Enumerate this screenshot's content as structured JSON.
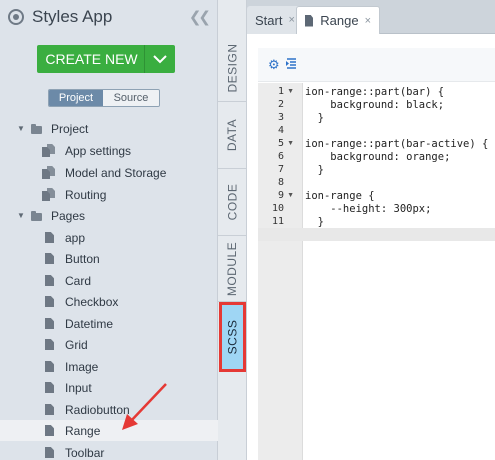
{
  "app": {
    "title": "Styles App"
  },
  "sidebar": {
    "create_button": "CREATE NEW",
    "segments": [
      "Project",
      "Source"
    ],
    "tree": [
      {
        "label": "Project",
        "kind": "folder",
        "level": 0
      },
      {
        "label": "App settings",
        "kind": "fileset",
        "level": 1
      },
      {
        "label": "Model and Storage",
        "kind": "fileset",
        "level": 1
      },
      {
        "label": "Routing",
        "kind": "fileset",
        "level": 1
      },
      {
        "label": "Pages",
        "kind": "folder",
        "level": 0
      },
      {
        "label": "app",
        "kind": "page",
        "level": 1
      },
      {
        "label": "Button",
        "kind": "file",
        "level": 1
      },
      {
        "label": "Card",
        "kind": "file",
        "level": 1
      },
      {
        "label": "Checkbox",
        "kind": "file",
        "level": 1
      },
      {
        "label": "Datetime",
        "kind": "file",
        "level": 1
      },
      {
        "label": "Grid",
        "kind": "file",
        "level": 1
      },
      {
        "label": "Image",
        "kind": "file",
        "level": 1
      },
      {
        "label": "Input",
        "kind": "file",
        "level": 1
      },
      {
        "label": "Radiobutton",
        "kind": "file",
        "level": 1
      },
      {
        "label": "Range",
        "kind": "file",
        "level": 1,
        "selected": true
      },
      {
        "label": "Toolbar",
        "kind": "file",
        "level": 1
      }
    ]
  },
  "vtabs": [
    "DESIGN",
    "DATA",
    "CODE",
    "MODULE",
    "SCSS"
  ],
  "tabs": [
    {
      "label": "Start",
      "close": "×"
    },
    {
      "label": "Range",
      "close": "×"
    }
  ],
  "editor": {
    "lines": [
      "ion-range::part(bar) {",
      "    background: black;",
      "  }",
      "",
      "ion-range::part(bar-active) {",
      "    background: orange;",
      "  }",
      "",
      "ion-range {",
      "    --height: 300px;",
      "  }",
      ""
    ]
  },
  "colors": {
    "accent_green": "#3aae40",
    "scss_highlight": "#9fd6f4",
    "scss_border": "#e53935"
  }
}
